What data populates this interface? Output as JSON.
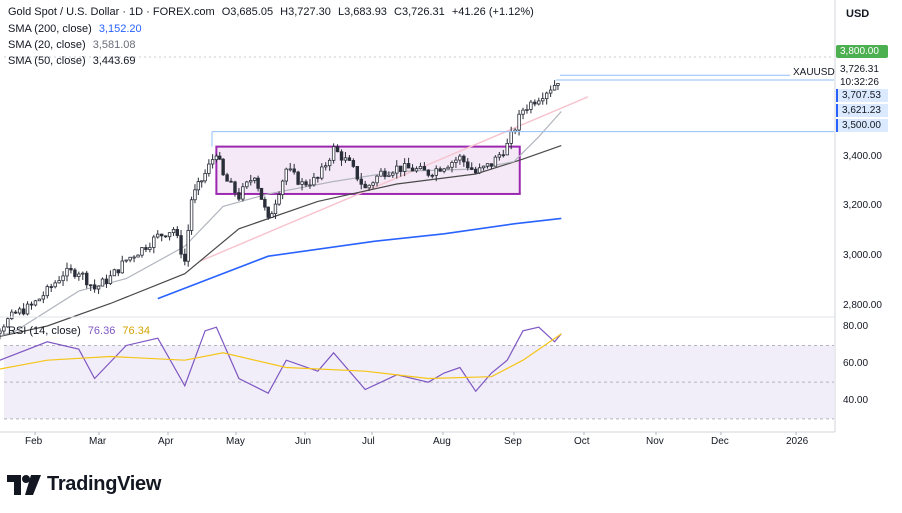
{
  "header": {
    "symbol_title": "Gold Spot / U.S. Dollar · 1D · FOREX.com",
    "open_label": "O",
    "open": "3,685.05",
    "high_label": "H",
    "high": "3,727.30",
    "low_label": "L",
    "low": "3,683.93",
    "close_label": "C",
    "close": "3,726.31",
    "change": "+41.26 (+1.12%)",
    "sma200_label": "SMA (200, close)",
    "sma200_value": "3,152.20",
    "sma20_label": "SMA (20, close)",
    "sma20_value": "3,581.08",
    "sma50_label": "SMA (50, close)",
    "sma50_value": "3,443.69"
  },
  "currency": "USD",
  "ticker": "XAUUSD",
  "price_labels": {
    "p3800": "3,800.00",
    "last": "3,726.31",
    "countdown": "10:32:26",
    "p3707": "3,707.53",
    "p3621": "3,621.23",
    "p3500": "3,500.00"
  },
  "rsi": {
    "label": "RSI (14, close)",
    "value1": "76.36",
    "value2": "76.34"
  },
  "brand": "TradingView",
  "colors": {
    "up": "#089981",
    "down": "#131722",
    "candle": "#2a2e39",
    "sma200": "#2962ff",
    "sma20": "#b2b5be",
    "sma50": "#4a4a4a",
    "trendline": "#f7c5cf",
    "box": "#9c27b0",
    "box_fill": "rgba(156,39,176,0.10)",
    "rsi_line": "#7e57c2",
    "rsi_ma": "#f5c518",
    "rsi_band": "rgba(126,87,194,0.10)",
    "hline": "#90bff9",
    "label_green": "#4caf50"
  },
  "chart_data": {
    "type": "candlestick",
    "title": "Gold Spot / U.S. Dollar · 1D · FOREX.com",
    "x_tick_labels": [
      "Feb",
      "Mar",
      "Apr",
      "May",
      "Jun",
      "Jul",
      "Aug",
      "Sep",
      "Oct",
      "Nov",
      "Dec",
      "2026"
    ],
    "price_axis": {
      "ticks": [
        "2,800.00",
        "3,000.00",
        "3,200.00",
        "3,400.00"
      ],
      "range": [
        2760,
        3860
      ]
    },
    "rsi_axis": {
      "ticks": [
        "40.00",
        "60.00",
        "80.00"
      ],
      "range": [
        25,
        85
      ],
      "band": [
        30,
        70
      ]
    },
    "horizontal_levels": [
      3726.31,
      3707.53,
      3621.23,
      3500.0
    ],
    "consolidation_box": {
      "start": "Apr 22",
      "end": "Sep 1",
      "price_low": 3250,
      "price_high": 3440
    },
    "close_series": [
      {
        "date": "Jan 2",
        "close": 2660
      },
      {
        "date": "Jan 9",
        "close": 2690
      },
      {
        "date": "Jan 16",
        "close": 2715
      },
      {
        "date": "Jan 23",
        "close": 2770
      },
      {
        "date": "Jan 30",
        "close": 2800
      },
      {
        "date": "Feb 6",
        "close": 2860
      },
      {
        "date": "Feb 13",
        "close": 2930
      },
      {
        "date": "Feb 20",
        "close": 2940
      },
      {
        "date": "Feb 27",
        "close": 2870
      },
      {
        "date": "Mar 6",
        "close": 2915
      },
      {
        "date": "Mar 13",
        "close": 2985
      },
      {
        "date": "Mar 20",
        "close": 3030
      },
      {
        "date": "Mar 27",
        "close": 3080
      },
      {
        "date": "Apr 3",
        "close": 3110
      },
      {
        "date": "Apr 8",
        "close": 2980
      },
      {
        "date": "Apr 11",
        "close": 3230
      },
      {
        "date": "Apr 17",
        "close": 3330
      },
      {
        "date": "Apr 22",
        "close": 3420
      },
      {
        "date": "Apr 25",
        "close": 3320
      },
      {
        "date": "May 2",
        "close": 3240
      },
      {
        "date": "May 9",
        "close": 3330
      },
      {
        "date": "May 15",
        "close": 3140
      },
      {
        "date": "May 23",
        "close": 3350
      },
      {
        "date": "May 30",
        "close": 3290
      },
      {
        "date": "Jun 6",
        "close": 3310
      },
      {
        "date": "Jun 13",
        "close": 3430
      },
      {
        "date": "Jun 20",
        "close": 3370
      },
      {
        "date": "Jun 27",
        "close": 3270
      },
      {
        "date": "Jul 4",
        "close": 3335
      },
      {
        "date": "Jul 11",
        "close": 3355
      },
      {
        "date": "Jul 18",
        "close": 3350
      },
      {
        "date": "Jul 25",
        "close": 3335
      },
      {
        "date": "Aug 1",
        "close": 3365
      },
      {
        "date": "Aug 8",
        "close": 3395
      },
      {
        "date": "Aug 15",
        "close": 3335
      },
      {
        "date": "Aug 22",
        "close": 3370
      },
      {
        "date": "Aug 29",
        "close": 3445
      },
      {
        "date": "Sep 5",
        "close": 3590
      },
      {
        "date": "Sep 12",
        "close": 3640
      },
      {
        "date": "Sep 19",
        "close": 3690
      },
      {
        "date": "Sep 22",
        "close": 3726.31
      }
    ],
    "series": [
      {
        "name": "SMA (200, close)",
        "last": 3152.2
      },
      {
        "name": "SMA (20, close)",
        "last": 3581.08
      },
      {
        "name": "SMA (50, close)",
        "last": 3443.69
      },
      {
        "name": "RSI (14, close)",
        "last": 76.36
      }
    ]
  }
}
